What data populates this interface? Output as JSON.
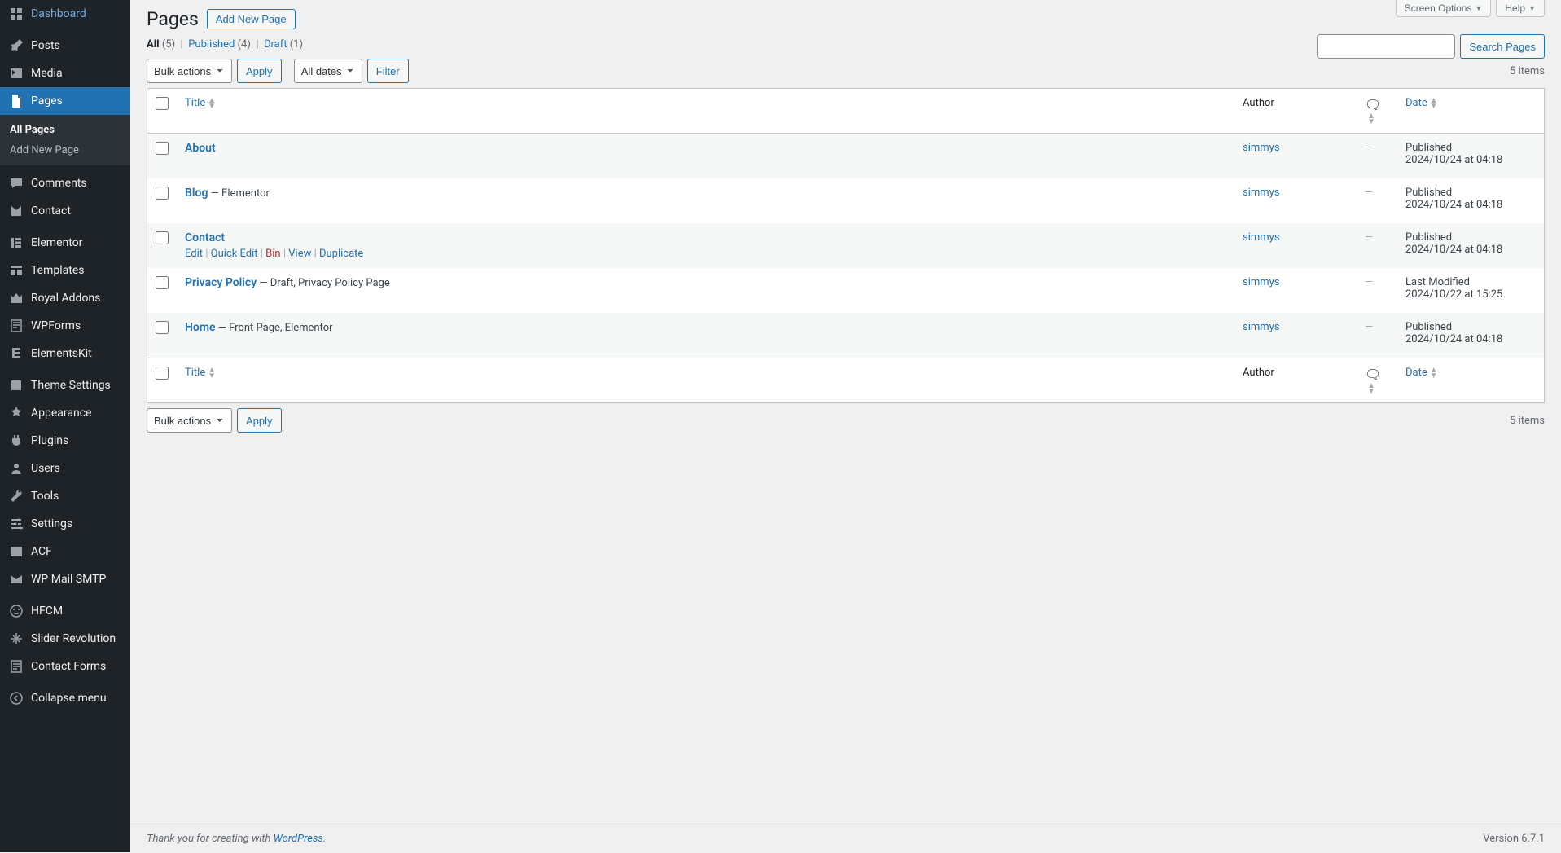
{
  "topbar": {
    "screen_options": "Screen Options",
    "help": "Help"
  },
  "sidebar": {
    "items": [
      {
        "icon": "dash",
        "label": "Dashboard"
      },
      {
        "icon": "pin",
        "label": "Posts"
      },
      {
        "icon": "media",
        "label": "Media"
      },
      {
        "icon": "page",
        "label": "Pages",
        "current": true
      },
      {
        "icon": "comment",
        "label": "Comments"
      },
      {
        "icon": "contact",
        "label": "Contact"
      },
      {
        "icon": "elementor",
        "label": "Elementor"
      },
      {
        "icon": "templates",
        "label": "Templates"
      },
      {
        "icon": "royal",
        "label": "Royal Addons"
      },
      {
        "icon": "wpforms",
        "label": "WPForms"
      },
      {
        "icon": "ekit",
        "label": "ElementsKit"
      },
      {
        "icon": "theme",
        "label": "Theme Settings"
      },
      {
        "icon": "appearance",
        "label": "Appearance"
      },
      {
        "icon": "plugins",
        "label": "Plugins"
      },
      {
        "icon": "users",
        "label": "Users"
      },
      {
        "icon": "tools",
        "label": "Tools"
      },
      {
        "icon": "settings",
        "label": "Settings"
      },
      {
        "icon": "acf",
        "label": "ACF"
      },
      {
        "icon": "mail",
        "label": "WP Mail SMTP"
      },
      {
        "icon": "hfcm",
        "label": "HFCM"
      },
      {
        "icon": "slider",
        "label": "Slider Revolution"
      },
      {
        "icon": "forms",
        "label": "Contact Forms"
      },
      {
        "icon": "collapse",
        "label": "Collapse menu"
      }
    ],
    "submenu": [
      {
        "label": "All Pages",
        "current": true
      },
      {
        "label": "Add New Page"
      }
    ]
  },
  "header": {
    "title": "Pages",
    "add_new": "Add New Page"
  },
  "filters": {
    "all_label": "All",
    "all_count": "(5)",
    "published_label": "Published",
    "published_count": "(4)",
    "draft_label": "Draft",
    "draft_count": "(1)"
  },
  "search": {
    "button": "Search Pages"
  },
  "bulk": {
    "select": "Bulk actions",
    "apply": "Apply",
    "dates": "All dates",
    "filter": "Filter"
  },
  "pagination": {
    "count": "5 items"
  },
  "columns": {
    "title": "Title",
    "author": "Author",
    "date": "Date"
  },
  "row_actions": {
    "edit": "Edit",
    "quick_edit": "Quick Edit",
    "bin": "Bin",
    "view": "View",
    "duplicate": "Duplicate"
  },
  "rows": [
    {
      "title": "About",
      "suffix": "",
      "author": "simmys",
      "comments": "—",
      "status": "Published",
      "date": "2024/10/24 at 04:18"
    },
    {
      "title": "Blog",
      "suffix": " — Elementor",
      "author": "simmys",
      "comments": "—",
      "status": "Published",
      "date": "2024/10/24 at 04:18"
    },
    {
      "title": "Contact",
      "suffix": "",
      "author": "simmys",
      "comments": "—",
      "status": "Published",
      "date": "2024/10/24 at 04:18",
      "show_actions": true
    },
    {
      "title": "Privacy Policy",
      "suffix": " — Draft, Privacy Policy Page",
      "author": "simmys",
      "comments": "—",
      "status": "Last Modified",
      "date": "2024/10/22 at 15:25"
    },
    {
      "title": "Home",
      "suffix": " — Front Page, Elementor",
      "author": "simmys",
      "comments": "—",
      "status": "Published",
      "date": "2024/10/24 at 04:18"
    }
  ],
  "footer": {
    "thanks_pre": "Thank you for creating with ",
    "wp": "WordPress",
    "thanks_post": ".",
    "version": "Version 6.7.1"
  }
}
